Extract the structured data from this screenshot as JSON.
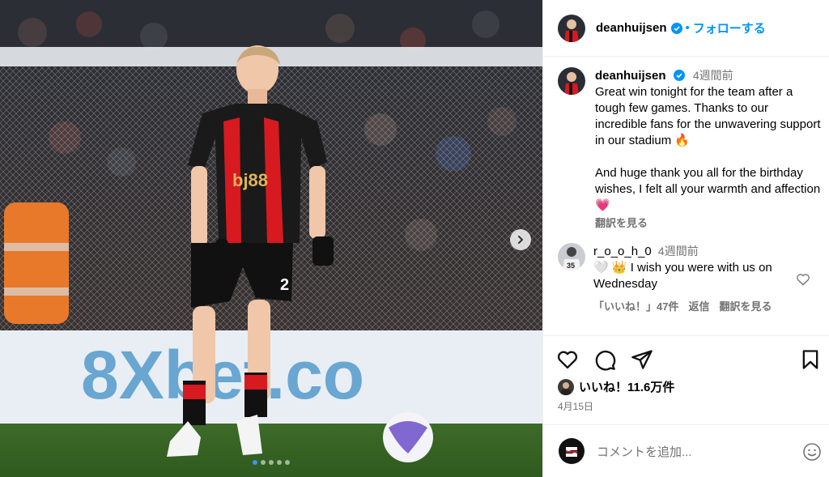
{
  "post": {
    "username": "deanhuijsen",
    "follow_label": "フォローする",
    "separator": "•"
  },
  "caption": {
    "username": "deanhuijsen",
    "time": "4週間前",
    "text_1": "Great win tonight for the team after a tough few games. Thanks to our incredible fans for the unwavering support in our stadium 🔥",
    "text_2": "And huge thank you all for the birthday wishes, I felt all your warmth and affection 💗",
    "translate": "翻訳を見る"
  },
  "reply": {
    "username": "r_o_o_h_0",
    "time": "4週間前",
    "text": "🤍 👑 I wish you were with us on Wednesday",
    "likes": "「いいね！」47件",
    "reply_label": "返信",
    "translate": "翻訳を見る",
    "avatar_number": "35"
  },
  "likes": {
    "text": "いいね！11.6万件"
  },
  "date": "4月15日",
  "comment_box": {
    "placeholder": "コメントを追加..."
  },
  "image": {
    "shirt_sponsor": "bj88",
    "board_text": "8Xbet.co",
    "shorts_number": "2",
    "carousel_dots": 5,
    "carousel_active": 1
  },
  "icons": [
    "verified-icon",
    "chevron-right-icon",
    "heart-icon",
    "comment-icon",
    "share-icon",
    "bookmark-icon",
    "emoji-icon",
    "small-heart-icon"
  ],
  "colors": {
    "accent": "#0095f6",
    "muted": "#737373",
    "kit_red": "#d71920"
  }
}
